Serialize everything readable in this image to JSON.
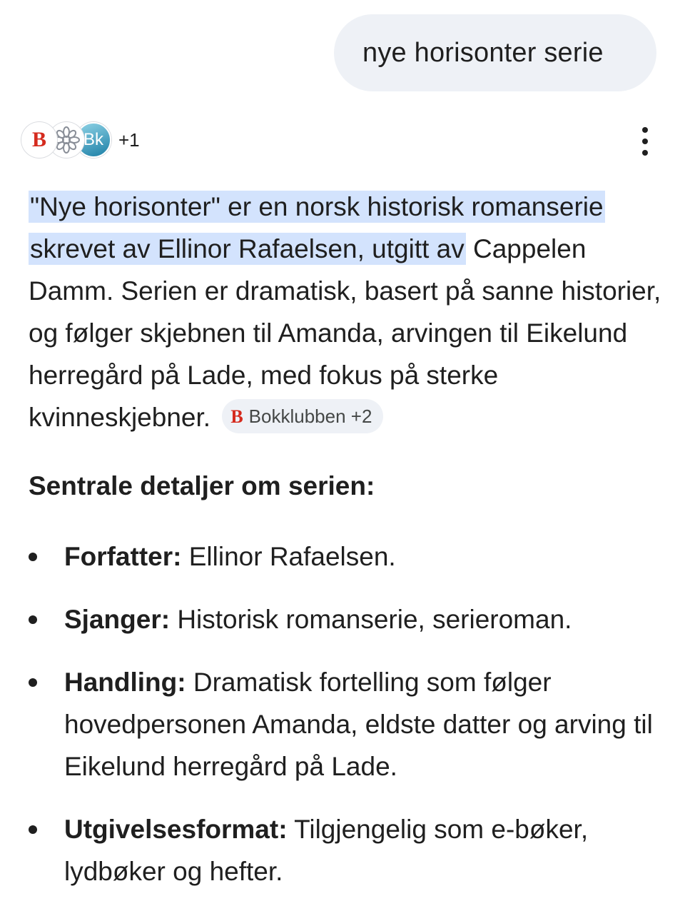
{
  "query": {
    "text": "nye horisonter serie"
  },
  "sources": {
    "icons": [
      "bokklubben-logo",
      "flower-logo",
      "bk-logo"
    ],
    "bokklubben_mark": "B",
    "bk_mark": "Bk",
    "extra_count": "+1"
  },
  "answer": {
    "highlight_1": "\"Nye horisonter\" er en norsk historisk romanserie skrevet av Ellinor Rafaelsen, utgitt av",
    "rest": " Cappelen Damm. Serien er dramatisk, basert på sanne historier, og følger skjebnen til Amanda, arvingen til Eikelund herregård på Lade, med fokus på sterke kvinneskjebner.",
    "chip": {
      "logo": "B",
      "label": "Bokklubben +2"
    }
  },
  "details": {
    "heading": "Sentrale detaljer om serien:",
    "items": [
      {
        "label": "Forfatter:",
        "text": " Ellinor Rafaelsen."
      },
      {
        "label": "Sjanger:",
        "text": " Historisk romanserie, serieroman."
      },
      {
        "label": "Handling:",
        "text": " Dramatisk fortelling som følger hovedpersonen Amanda, eldste datter og arving til Eikelund herregård på Lade."
      },
      {
        "label": "Utgivelsesformat:",
        "text": " Tilgjengelig som e-bøker, lydbøker og hefter."
      }
    ]
  },
  "colors": {
    "query_bubble": "#eef1f6",
    "highlight": "#d3e3fd",
    "text": "#1f1f1f",
    "bokklubben_red": "#d52b1e"
  }
}
